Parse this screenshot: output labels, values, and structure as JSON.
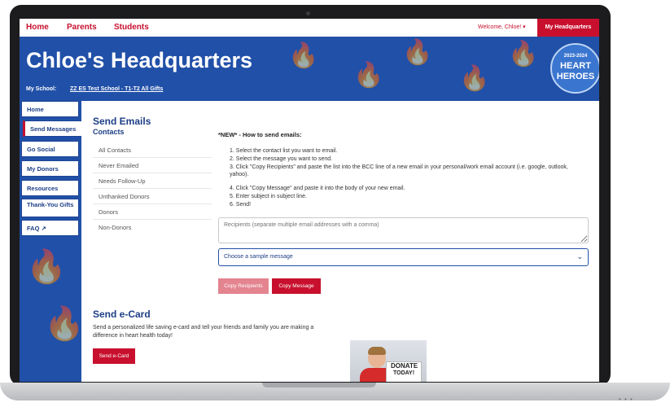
{
  "topnav": {
    "links": [
      "Home",
      "Parents",
      "Students"
    ],
    "welcome": "Welcome, Chloe! ▾",
    "hq_button": "My Headquarters"
  },
  "banner": {
    "title": "Chloe's Headquarters",
    "school_label": "My School:",
    "school_name": "ZZ ES Test School - T1-T2 All Gifts",
    "badge": {
      "year": "2023-2024",
      "line1": "HEART",
      "line2": "HEROES"
    }
  },
  "sidebar": {
    "items": [
      {
        "label": "Home"
      },
      {
        "label": "Send Messages"
      },
      {
        "label": "Go Social"
      },
      {
        "label": "My Donors"
      },
      {
        "label": "Resources"
      },
      {
        "label": "Thank-You Gifts"
      },
      {
        "label": "FAQ ↗"
      }
    ]
  },
  "main": {
    "send_title": "Send Emails",
    "contacts_title": "Contacts",
    "contacts": [
      "All Contacts",
      "Never Emailed",
      "Needs Follow-Up",
      "Unthanked Donors",
      "Donors",
      "Non-Donors"
    ],
    "how_title": "*NEW* - How to send emails:",
    "steps": [
      "1. Select the contact list you want to email.",
      "2. Select the message you want to send.",
      "3. Click \"Copy Recipients\" and paste the list into the BCC line of a new email in your personal/work email account (i.e. google, outlook, yahoo).",
      "4. Click \"Copy Message\" and paste it into the body of your new email.",
      "5. Enter subject in subject line.",
      "6. Send!"
    ],
    "recipients_placeholder": "Recipients (separate multiple email addresses with a comma)",
    "select_value": "Choose a sample message",
    "copy_recipients": "Copy Recipients",
    "copy_message": "Copy Message",
    "ecard_title": "Send e-Card",
    "ecard_text": "Send a personalized life saving e-card and tell your friends and family you are making a difference in heart health today!",
    "ecard_button": "Send e-Card",
    "photo_sign": {
      "line1": "DONATE",
      "line2": "TODAY!"
    }
  },
  "colors": {
    "brand_red": "#c8102e",
    "brand_blue": "#2150a8"
  }
}
